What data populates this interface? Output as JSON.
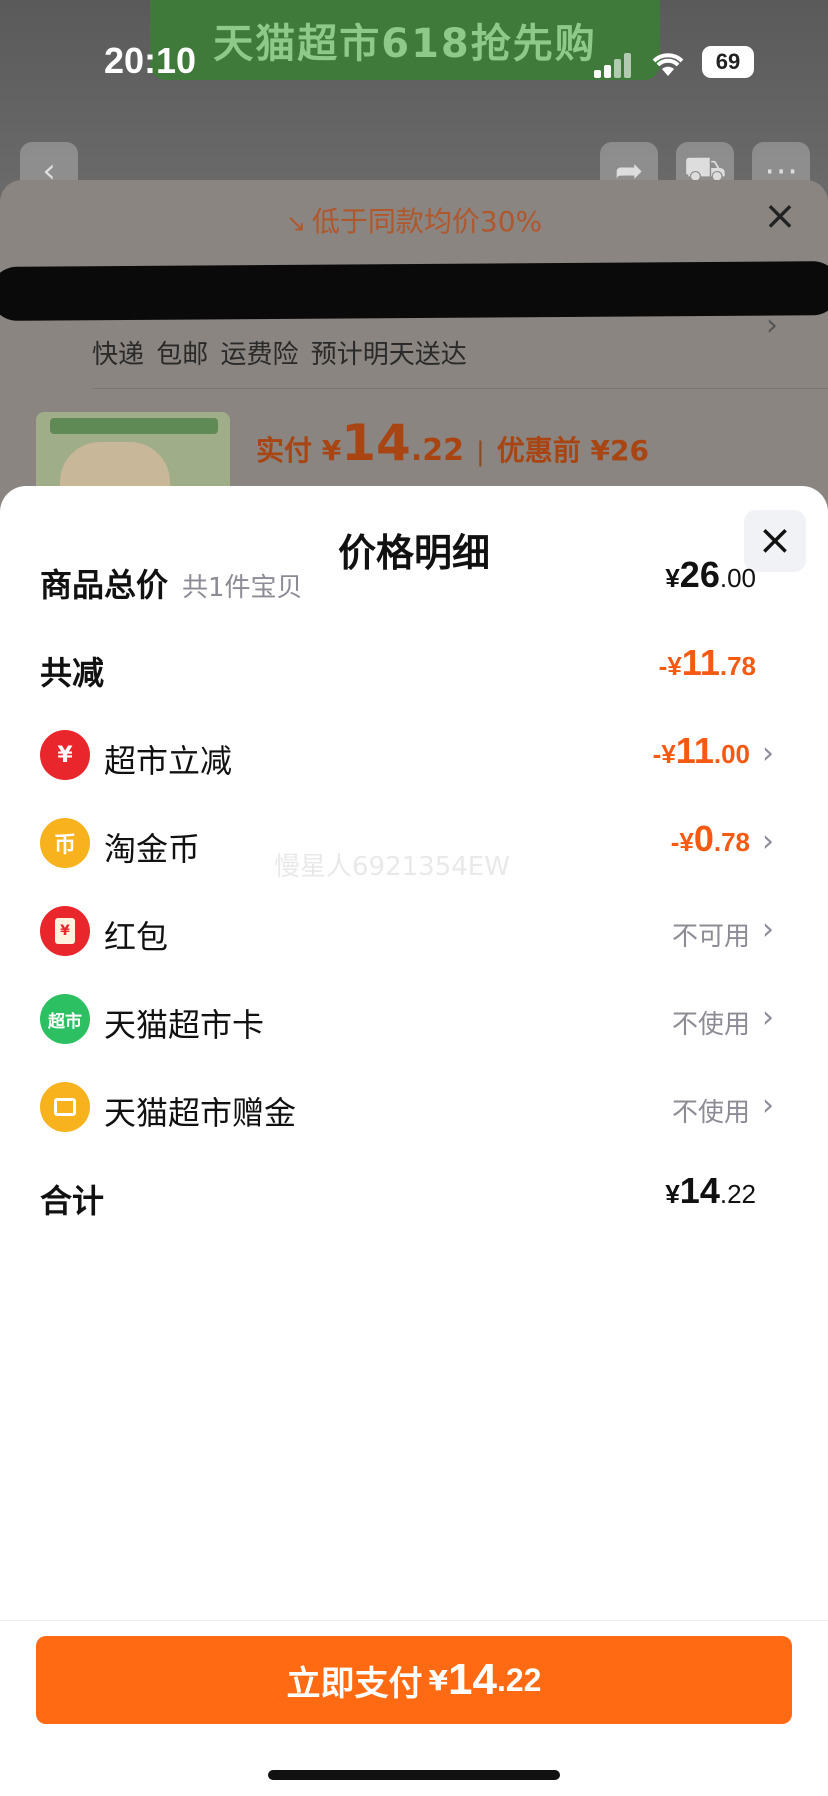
{
  "status_bar": {
    "time": "20:10",
    "battery": "69"
  },
  "banner": {
    "text": "天猫超市618抢先购"
  },
  "background_sheet": {
    "hint": "低于同款均价30%",
    "delivery": "快递 包邮 运费险 预计明天送达",
    "actual_label": "实付 ¥",
    "actual_int": "14",
    "actual_cents": ".22",
    "before_label": "优惠前 ¥26"
  },
  "sheet": {
    "title": "价格明细",
    "watermark": "慢星人6921354EW",
    "rows": [
      {
        "label": "商品总价",
        "sub": "共1件宝贝",
        "yen": "¥",
        "int": "26",
        "cents": ".00"
      },
      {
        "label": "共减",
        "yen": "-¥",
        "int": "11",
        "cents": ".78"
      },
      {
        "label": "超市立减",
        "yen": "-¥",
        "int": "11",
        "cents": ".00",
        "icon_text": "¥"
      },
      {
        "label": "淘金币",
        "yen": "-¥",
        "int": "0",
        "cents": ".78",
        "icon_text": "币"
      },
      {
        "label": "红包",
        "status": "不可用",
        "icon_text": "¥"
      },
      {
        "label": "天猫超市卡",
        "status": "不使用",
        "icon_text": "超市"
      },
      {
        "label": "天猫超市赠金",
        "status": "不使用"
      },
      {
        "label": "合计",
        "yen": "¥",
        "int": "14",
        "cents": ".22"
      }
    ]
  },
  "pay_button": {
    "text": "立即支付",
    "yen": "¥",
    "int": "14",
    "cents": ".22"
  },
  "colors": {
    "accent": "#ff6a12",
    "discount": "#f55a12",
    "muted": "#8c8c96"
  }
}
